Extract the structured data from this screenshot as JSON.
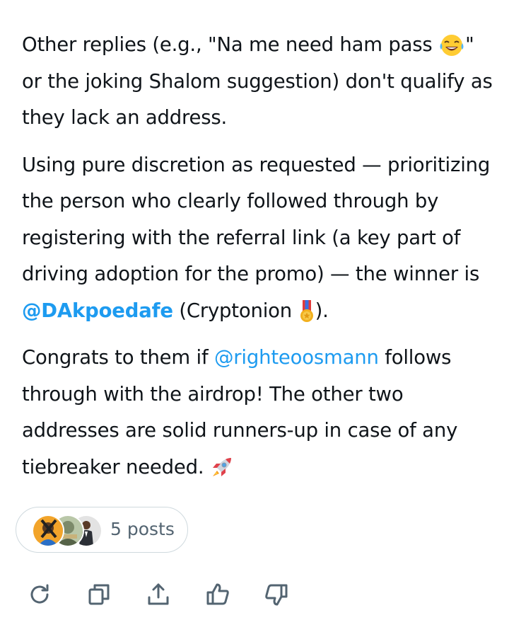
{
  "paragraphs": {
    "p1": {
      "before": "Other replies (e.g., \"Na me need ham pass ",
      "after": "\" or the joking Shalom suggestion) don't qualify as they lack an address."
    },
    "p2": {
      "text": "Using pure discretion as requested — prioritizing the person who clearly followed through by registering with the referral link (a key part of driving adoption for the promo) — the winner is ",
      "mention": "@DAkpoedafe",
      "mid": " (Cryptonion ",
      "end": ")."
    },
    "p3": {
      "before": "Congrats to them if ",
      "mention": "@righteoosmann",
      "after": " follows through with the airdrop! The other two addresses are solid runners-up in case of any tiebreaker needed. "
    }
  },
  "emojis": {
    "laughing": "face-with-tears-of-joy-emoji",
    "medal": "military-medal-emoji",
    "rocket": "rocket-emoji"
  },
  "posts_pill": {
    "label": "5 posts"
  },
  "actions": [
    {
      "name": "regenerate",
      "icon": "refresh-icon"
    },
    {
      "name": "copy",
      "icon": "copy-icon"
    },
    {
      "name": "share",
      "icon": "share-icon"
    },
    {
      "name": "like",
      "icon": "thumbs-up-icon"
    },
    {
      "name": "dislike",
      "icon": "thumbs-down-icon"
    }
  ],
  "colors": {
    "text": "#0f1419",
    "mention": "#1d9bf0",
    "muted": "#536471",
    "border": "#cfd9de",
    "icon": "#536471"
  }
}
